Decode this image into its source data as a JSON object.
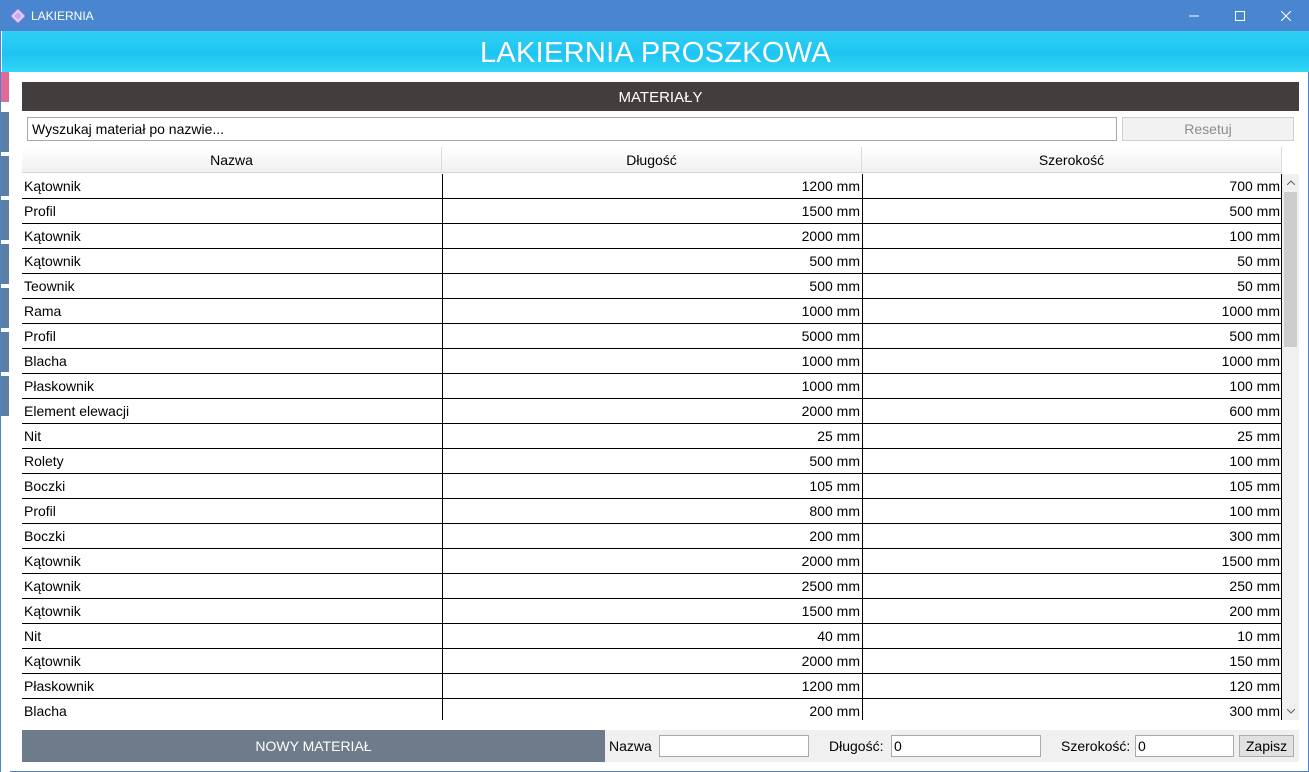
{
  "window": {
    "title": "LAKIERNIA",
    "min_icon": "minimize-icon",
    "max_icon": "maximize-icon",
    "close_icon": "close-icon",
    "accent": "#4a86cf"
  },
  "header": {
    "title": "LAKIERNIA PROSZKOWA",
    "color": "#1ec4f2"
  },
  "section": {
    "title": "MATERIAŁY"
  },
  "search": {
    "value": "Wyszukaj materiał po nazwie...",
    "reset_label": "Resetuj"
  },
  "table": {
    "columns": [
      "Nazwa",
      "Długość",
      "Szerokość"
    ],
    "rows": [
      {
        "name": "Kątownik",
        "length": "1200 mm",
        "width": "700 mm"
      },
      {
        "name": "Profil",
        "length": "1500 mm",
        "width": "500 mm"
      },
      {
        "name": "Kątownik",
        "length": "2000 mm",
        "width": "100 mm"
      },
      {
        "name": "Kątownik",
        "length": "500 mm",
        "width": "50 mm"
      },
      {
        "name": "Teownik",
        "length": "500 mm",
        "width": "50 mm"
      },
      {
        "name": "Rama",
        "length": "1000 mm",
        "width": "1000 mm"
      },
      {
        "name": "Profil",
        "length": "5000 mm",
        "width": "500 mm"
      },
      {
        "name": "Blacha",
        "length": "1000 mm",
        "width": "1000 mm"
      },
      {
        "name": "Płaskownik",
        "length": "1000 mm",
        "width": "100 mm"
      },
      {
        "name": "Element elewacji",
        "length": "2000 mm",
        "width": "600 mm"
      },
      {
        "name": "Nit",
        "length": "25 mm",
        "width": "25 mm"
      },
      {
        "name": "Rolety",
        "length": "500 mm",
        "width": "100 mm"
      },
      {
        "name": "Boczki",
        "length": "105 mm",
        "width": "105 mm"
      },
      {
        "name": "Profil",
        "length": "800 mm",
        "width": "100 mm"
      },
      {
        "name": "Boczki",
        "length": "200 mm",
        "width": "300 mm"
      },
      {
        "name": "Kątownik",
        "length": "2000 mm",
        "width": "1500 mm"
      },
      {
        "name": "Kątownik",
        "length": "2500 mm",
        "width": "250 mm"
      },
      {
        "name": "Kątownik",
        "length": "1500 mm",
        "width": "200 mm"
      },
      {
        "name": "Nit",
        "length": "40 mm",
        "width": "10 mm"
      },
      {
        "name": "Kątownik",
        "length": "2000 mm",
        "width": "150 mm"
      },
      {
        "name": "Płaskownik",
        "length": "1200 mm",
        "width": "120 mm"
      },
      {
        "name": "Blacha",
        "length": "200 mm",
        "width": "300 mm"
      }
    ]
  },
  "footer": {
    "new_material_label": "NOWY MATERIAŁ",
    "name_label": "Nazwa",
    "name_value": "",
    "length_label": "Długość:",
    "length_value": "0",
    "width_label": "Szerokość:",
    "width_value": "0",
    "save_label": "Zapisz"
  }
}
